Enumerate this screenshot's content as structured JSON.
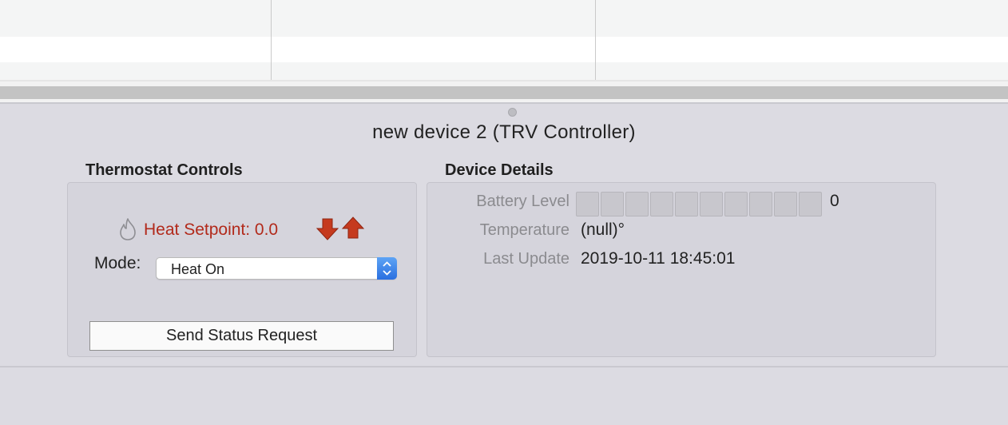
{
  "device_title": "new device 2 (TRV Controller)",
  "thermostat": {
    "section_title": "Thermostat Controls",
    "setpoint_text": "Heat Setpoint: 0.0",
    "mode_label": "Mode:",
    "mode_value": "Heat On",
    "status_button": "Send Status Request",
    "icons": [
      "flame-icon",
      "arrow-down-icon",
      "arrow-up-icon",
      "stepper-icon"
    ],
    "setpoint_color": "#b22a1b"
  },
  "details": {
    "section_title": "Device Details",
    "battery_label": "Battery Level",
    "battery_value": "0",
    "battery_level": 0,
    "temperature_label": "Temperature",
    "temperature_value": "(null)°",
    "last_update_label": "Last Update",
    "last_update_value": "2019-10-11 18:45:01"
  }
}
